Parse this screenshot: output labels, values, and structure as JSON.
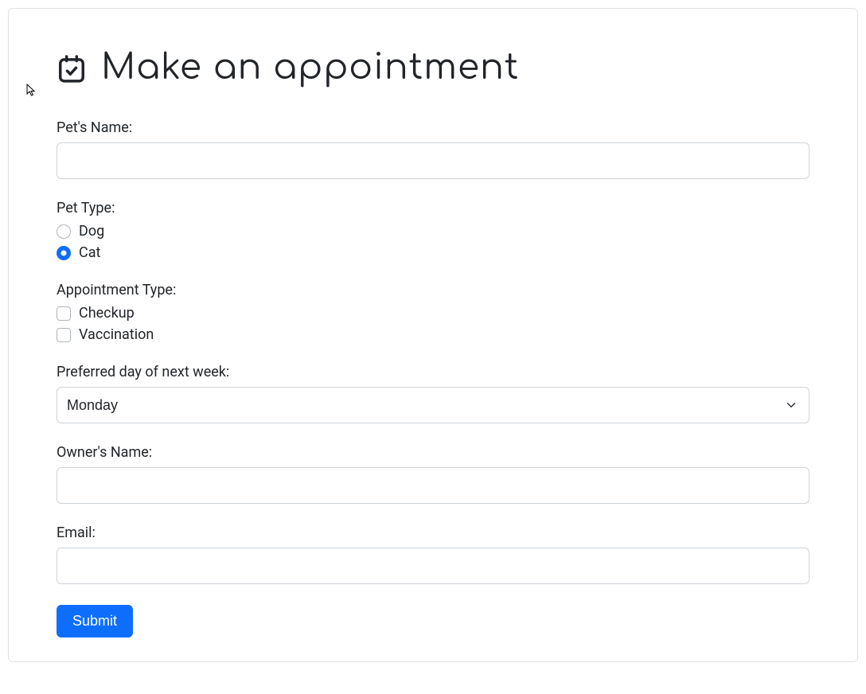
{
  "heading": "Make an appointment",
  "fields": {
    "petName": {
      "label": "Pet's Name:",
      "value": ""
    },
    "petType": {
      "label": "Pet Type:",
      "options": [
        {
          "label": "Dog",
          "checked": false
        },
        {
          "label": "Cat",
          "checked": true
        }
      ]
    },
    "apptType": {
      "label": "Appointment Type:",
      "options": [
        {
          "label": "Checkup",
          "checked": false
        },
        {
          "label": "Vaccination",
          "checked": false
        }
      ]
    },
    "preferredDay": {
      "label": "Preferred day of next week:",
      "selected": "Monday"
    },
    "ownerName": {
      "label": "Owner's Name:",
      "value": ""
    },
    "email": {
      "label": "Email:",
      "value": ""
    }
  },
  "submitLabel": "Submit"
}
